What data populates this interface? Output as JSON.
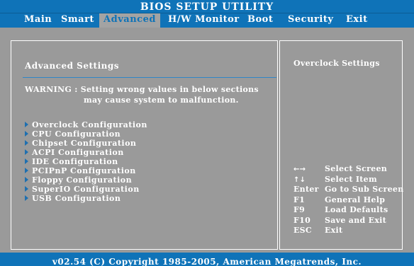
{
  "window": {
    "title": "BIOS SETUP UTILITY"
  },
  "tabs": [
    {
      "label": "Main"
    },
    {
      "label": "Smart"
    },
    {
      "label": "Advanced"
    },
    {
      "label": "H/W Monitor"
    },
    {
      "label": "Boot"
    },
    {
      "label": "Security"
    },
    {
      "label": "Exit"
    }
  ],
  "active_tab": "Advanced",
  "main": {
    "title": "Advanced Settings",
    "warning_line1": "WARNING : Setting wrong values in below sections",
    "warning_line2": "may cause system to malfunction.",
    "items": [
      {
        "label": "Overclock Configuration",
        "selected": true
      },
      {
        "label": "CPU Configuration"
      },
      {
        "label": "Chipset Configuration"
      },
      {
        "label": "ACPI Configuration"
      },
      {
        "label": "IDE Configuration"
      },
      {
        "label": "PCIPnP Configuration"
      },
      {
        "label": "Floppy Configuration"
      },
      {
        "label": "SuperIO Configuration"
      },
      {
        "label": "USB Configuration"
      }
    ]
  },
  "help": {
    "title": "Overclock Settings",
    "keys": [
      {
        "key": "←→",
        "action": "Select Screen"
      },
      {
        "key": "↑↓",
        "action": "Select Item"
      },
      {
        "key": "Enter",
        "action": "Go to Sub Screen"
      },
      {
        "key": "F1",
        "action": "General Help"
      },
      {
        "key": "F9",
        "action": "Load Defaults"
      },
      {
        "key": "F10",
        "action": "Save and Exit"
      },
      {
        "key": "ESC",
        "action": "Exit"
      }
    ]
  },
  "footer": {
    "text": "v02.54 (C) Copyright 1985-2005, American Megatrends, Inc."
  },
  "colors": {
    "accent": "#0f73b8",
    "background": "#9a9a9a",
    "text": "#ffffff",
    "arrow": "#1e6fb0"
  }
}
